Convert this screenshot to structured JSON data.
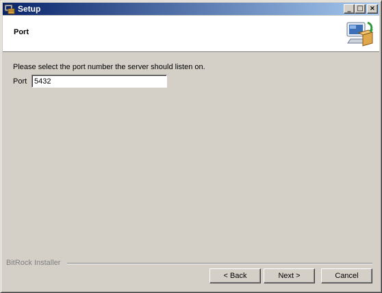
{
  "window": {
    "title": "Setup",
    "minimize_glyph": "_",
    "maximize_glyph": "□",
    "close_glyph": "×"
  },
  "header": {
    "title": "Port"
  },
  "content": {
    "instruction": "Please select the port number the server should listen on.",
    "port_label": "Port",
    "port_value": "5432"
  },
  "footer": {
    "brand": "BitRock Installer",
    "back_label": "< Back",
    "next_label": "Next >",
    "cancel_label": "Cancel"
  },
  "colors": {
    "titlebar_start": "#0a246a",
    "titlebar_end": "#a6caf0",
    "window_bg": "#d4d0c8"
  }
}
